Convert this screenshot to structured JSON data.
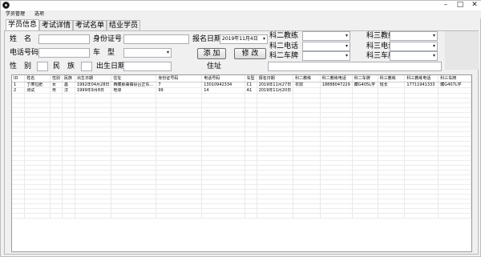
{
  "menu": [
    "学员管理",
    "选项"
  ],
  "window_buttons": [
    "–",
    "□",
    "✕"
  ],
  "tabs": [
    "学员信息",
    "考试详情",
    "考试名单",
    "结业学员"
  ],
  "form": {
    "name_label": "姓　名",
    "id_label": "身份证号",
    "reg_date_label": "报名日期",
    "reg_date_value": "2019年11月4日",
    "phone_label": "电话号码",
    "car_label": "车　型",
    "gender_label": "性　别",
    "ethnic_label": "民　族",
    "birth_label": "出生日期",
    "address_label": "住址",
    "add_button": "添 加",
    "edit_button": "修 改",
    "k2_coach_label": "科二教练",
    "k2_phone_label": "科二电话",
    "k2_plate_label": "科二车牌",
    "k3_coach_label": "科三教练",
    "k3_phone_label": "科三电话",
    "k3_plate_label": "科三车牌"
  },
  "table": {
    "columns": [
      "ID",
      "姓名",
      "性别",
      "民族",
      "出生日期",
      "住址",
      "身份证号码",
      "电话号码",
      "车型",
      "报名日期",
      "科二教练",
      "科二教练电话",
      "科二车牌",
      "科三教练",
      "科三教练电话",
      "科三车牌"
    ],
    "rows": [
      [
        "1",
        "丁摩拉肥",
        "女",
        "蠡",
        "1992年04月28日",
        "西藏那曲镇县吕正东…",
        "7",
        "13010942334",
        "C1",
        "2019年11月27日",
        "农奴",
        "18888047229",
        "藏G405L学",
        "班长",
        "17711941333",
        "藏G407L学"
      ],
      [
        "2",
        "测试",
        "男",
        "汉",
        "1999年9月8日",
        "地球",
        "99",
        "14",
        "A1",
        "2019年11月20日",
        "",
        "",
        "",
        "",
        "",
        ""
      ]
    ]
  }
}
